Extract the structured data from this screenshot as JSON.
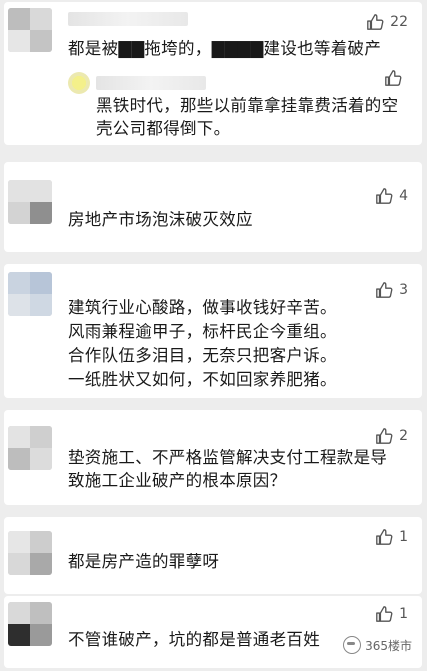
{
  "colors": {
    "background": "#ededed",
    "card": "#ffffff",
    "text": "#191919",
    "muted": "#555555"
  },
  "comments": [
    {
      "text": "都是被▇▇拖垮的，▇▇▇▇建设也等着破产",
      "likes": "22",
      "reply": {
        "text": "黑铁时代，那些以前靠拿挂靠费活着的空\n壳公司都得倒下。",
        "likes": ""
      }
    },
    {
      "text": "房地产市场泡沫破灭效应",
      "likes": "4"
    },
    {
      "text": "建筑行业心酸路，做事收钱好辛苦。\n风雨兼程逾甲子，标杆民企今重组。\n合作队伍多泪目，无奈只把客户诉。\n一纸胜状又如何，不如回家养肥猪。",
      "likes": "3"
    },
    {
      "text": "垫资施工、不严格监管解决支付工程款是导\n致施工企业破产的根本原因？",
      "likes": "2"
    },
    {
      "text": "都是房产造的罪孽呀",
      "likes": "1"
    },
    {
      "text": "不管谁破产，坑的都是普通老百姓",
      "likes": "1"
    }
  ],
  "icons": {
    "like": "thumbs-up-icon",
    "watermark": "wechat-icon"
  },
  "watermark": {
    "text": "365楼市"
  }
}
